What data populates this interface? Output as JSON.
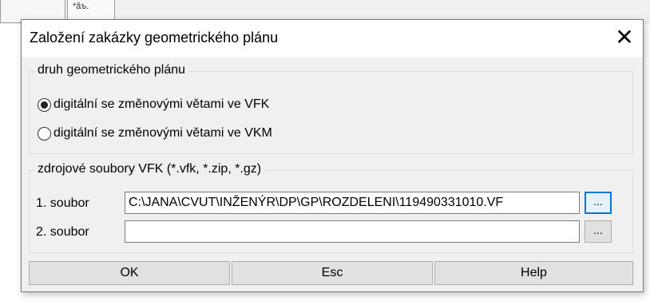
{
  "background": {
    "tab_glyph": "*ăъ."
  },
  "dialog": {
    "title": "Založení zakázky geometrického plánu",
    "close_glyph": "✕"
  },
  "type_group": {
    "label": "druh geometrického plánu",
    "options": [
      {
        "label": "digitální se změnovými větami ve VFK",
        "selected": true
      },
      {
        "label": "digitální se změnovými větami ve VKM",
        "selected": false
      }
    ]
  },
  "source_group": {
    "label": "zdrojové soubory VFK (*.vfk, *.zip, *.gz)",
    "file1": {
      "label": "1. soubor",
      "value": "C:\\JANA\\CVUT\\INŽENÝR\\DP\\GP\\ROZDELENI\\119490331010.VF",
      "browse": "..."
    },
    "file2": {
      "label": "2. soubor",
      "value": "",
      "browse": "..."
    }
  },
  "buttons": {
    "ok": "OK",
    "esc": "Esc",
    "help": "Help"
  }
}
